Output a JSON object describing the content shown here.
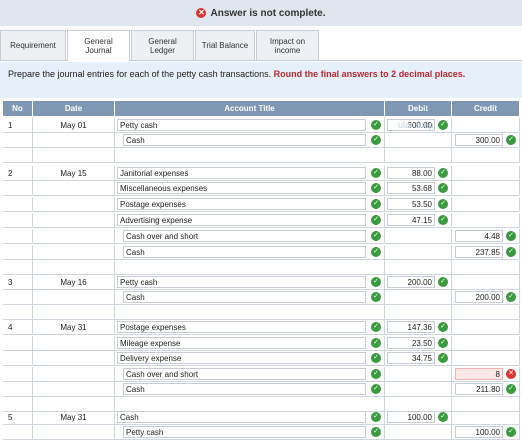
{
  "banner": {
    "text": "Answer is not complete."
  },
  "tabs": [
    {
      "label": "Requirement"
    },
    {
      "label": "General Journal"
    },
    {
      "label": "General Ledger"
    },
    {
      "label": "Trial Balance"
    },
    {
      "label": "Impact on income"
    }
  ],
  "instructions": {
    "text": "Prepare the journal entries for each of the petty cash transactions.",
    "highlight": "Round the final answers to 2 decimal places."
  },
  "table": {
    "headers": {
      "no": "No",
      "date": "Date",
      "account": "Account Title",
      "debit": "Debit",
      "credit": "Credit"
    },
    "rows": [
      {
        "no": "1",
        "date": "May 01",
        "account": "Petty cash",
        "debit": "300.00",
        "credit": ""
      },
      {
        "no": "",
        "date": "",
        "account": "Cash",
        "debit": "",
        "credit": "300.00"
      },
      {
        "no": "",
        "date": "",
        "account": "",
        "debit": "",
        "credit": ""
      },
      {
        "no": "2",
        "date": "May 15",
        "account": "Janitorial expenses",
        "debit": "88.00",
        "credit": ""
      },
      {
        "no": "",
        "date": "",
        "account": "Miscellaneous expenses",
        "debit": "53.68",
        "credit": ""
      },
      {
        "no": "",
        "date": "",
        "account": "Postage expenses",
        "debit": "53.50",
        "credit": ""
      },
      {
        "no": "",
        "date": "",
        "account": "Advertising expense",
        "debit": "47.15",
        "credit": ""
      },
      {
        "no": "",
        "date": "",
        "account": "Cash over and short",
        "debit": "",
        "credit": "4.48"
      },
      {
        "no": "",
        "date": "",
        "account": "Cash",
        "debit": "",
        "credit": "237.85"
      },
      {
        "no": "",
        "date": "",
        "account": "",
        "debit": "",
        "credit": ""
      },
      {
        "no": "3",
        "date": "May 16",
        "account": "Petty cash",
        "debit": "200.00",
        "credit": ""
      },
      {
        "no": "",
        "date": "",
        "account": "Cash",
        "debit": "",
        "credit": "200.00"
      },
      {
        "no": "",
        "date": "",
        "account": "",
        "debit": "",
        "credit": ""
      },
      {
        "no": "4",
        "date": "May 31",
        "account": "Postage expenses",
        "debit": "147.36",
        "credit": ""
      },
      {
        "no": "",
        "date": "",
        "account": "Mileage expense",
        "debit": "23.50",
        "credit": ""
      },
      {
        "no": "",
        "date": "",
        "account": "Delivery expense",
        "debit": "34.75",
        "credit": ""
      },
      {
        "no": "",
        "date": "",
        "account": "Cash over and short",
        "debit": "",
        "credit": "8"
      },
      {
        "no": "",
        "date": "",
        "account": "Cash",
        "debit": "",
        "credit": "211.80"
      },
      {
        "no": "",
        "date": "",
        "account": "",
        "debit": "",
        "credit": ""
      },
      {
        "no": "5",
        "date": "May 31",
        "account": "Cash",
        "debit": "100.00",
        "credit": ""
      },
      {
        "no": "",
        "date": "",
        "account": "Petty cash",
        "debit": "",
        "credit": "100.00"
      }
    ]
  },
  "watermark": "ular Snip",
  "colors": {
    "header": "#7f97b2",
    "check": "#3a9a3e",
    "error": "#dd3333",
    "highlight": "#c0272d"
  }
}
